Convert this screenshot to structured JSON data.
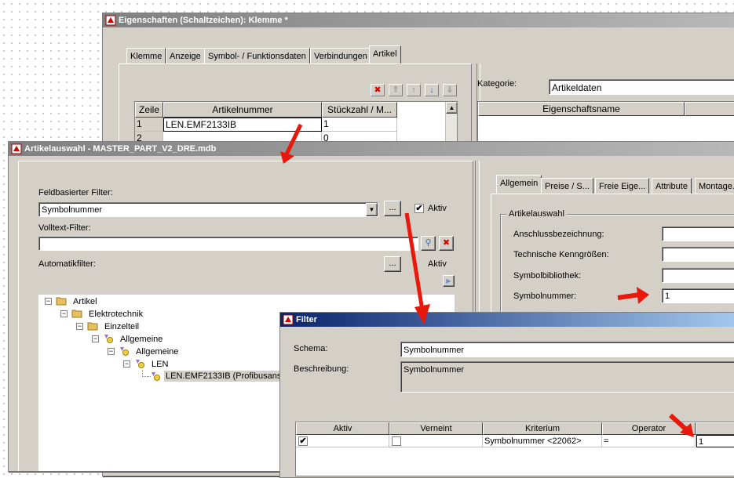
{
  "win1": {
    "title": "Eigenschaften (Schaltzeichen): Klemme *",
    "tabs": [
      "Klemme",
      "Anzeige",
      "Symbol- / Funktionsdaten",
      "Verbindungen",
      "Artikel"
    ],
    "table": {
      "headers": [
        "Zeile",
        "Artikelnummer",
        "Stückzahl / M..."
      ],
      "rows": [
        {
          "zeile": "1",
          "artikelnummer": "LEN.EMF2133IB",
          "stueck": "1"
        },
        {
          "zeile": "2",
          "artikelnummer": "",
          "stueck": "0"
        }
      ]
    },
    "kategorie_label": "Kategorie:",
    "kategorie_value": "Artikeldaten",
    "eigenschaft_header": "Eigenschaftsname"
  },
  "win2": {
    "title": "Artikelauswahl - MASTER_PART_V2_DRE.mdb",
    "feldfilter_label": "Feldbasierter Filter:",
    "feldfilter_value": "Symbolnummer",
    "ellipsis": "...",
    "aktiv_label": "Aktiv",
    "volltext_label": "Volltext-Filter:",
    "volltext_value": "",
    "auto_label": "Automatikfilter:",
    "auto_aktiv_label": "Aktiv",
    "tree": [
      "Artikel",
      "Elektrotechnik",
      "Einzelteil",
      "Allgemeine",
      "Allgemeine",
      "LEN",
      "LEN.EMF2133IB (Profibusansc"
    ],
    "tabs": [
      "Allgemein",
      "Preise / S...",
      "Freie Eige...",
      "Attribute",
      "Montage..."
    ],
    "group_label": "Artikelauswahl",
    "fields": [
      {
        "label": "Anschlussbezeichnung:",
        "value": ""
      },
      {
        "label": "Technische Kenngrößen:",
        "value": ""
      },
      {
        "label": "Symbolbibliothek:",
        "value": ""
      },
      {
        "label": "Symbolnummer:",
        "value": "1"
      }
    ]
  },
  "win3": {
    "title": "Filter",
    "schema_label": "Schema:",
    "schema_value": "Symbolnummer",
    "beschreibung_label": "Beschreibung:",
    "beschreibung_value": "Symbolnummer",
    "table": {
      "headers": [
        "Aktiv",
        "Verneint",
        "Kriterium",
        "Operator",
        ""
      ],
      "row": {
        "aktiv": "✔",
        "verneint": "",
        "kriterium": "Symbolnummer <22062>",
        "operator": "=",
        "wert": "1"
      }
    }
  },
  "colors": {
    "arrow": "#e8180c",
    "titlebar_active": "#0a246a",
    "face": "#d4d0c8"
  }
}
